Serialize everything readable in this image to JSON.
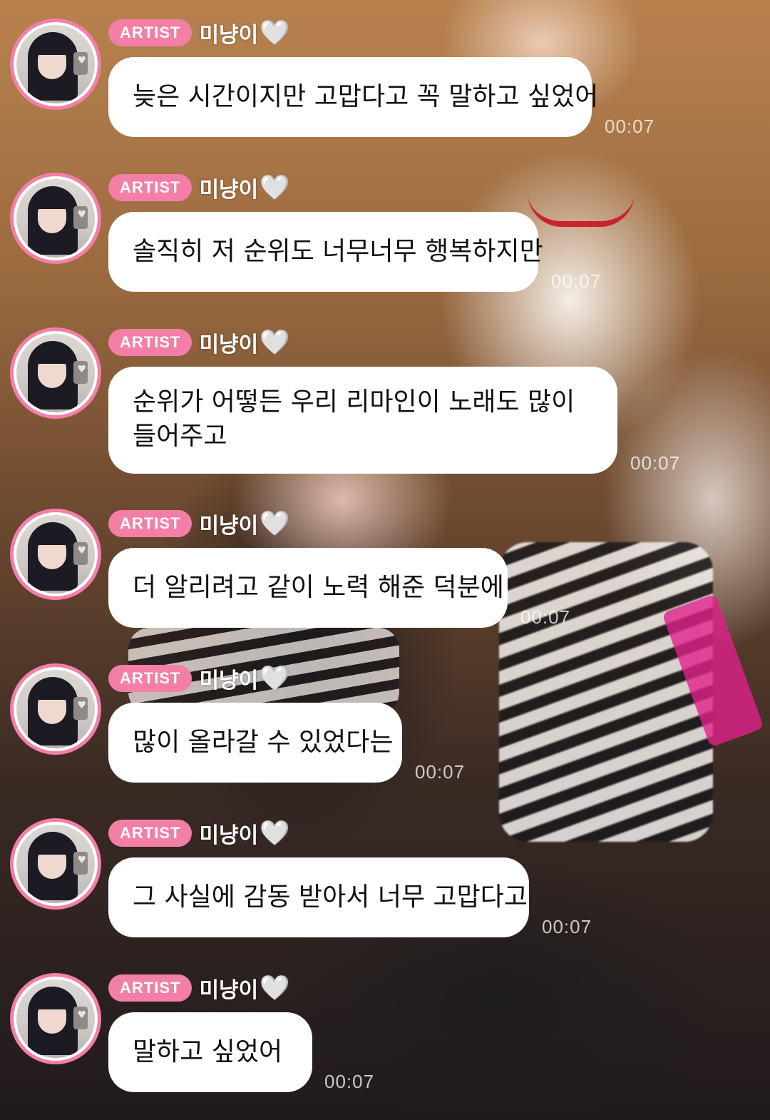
{
  "colors": {
    "badge": "#f37fa7",
    "avatar_ring": "#f47fa8",
    "bubble": "#ffffff",
    "text": "#111111"
  },
  "messages": [
    {
      "badge": "ARTIST",
      "username": "미냥이",
      "heart": "🤍",
      "text": "늦은 시간이지만 고맙다고 꼭 말하고 싶었어",
      "time": "00:07"
    },
    {
      "badge": "ARTIST",
      "username": "미냥이",
      "heart": "🤍",
      "text": "솔직히 저 순위도 너무너무 행복하지만",
      "time": "00:07"
    },
    {
      "badge": "ARTIST",
      "username": "미냥이",
      "heart": "🤍",
      "text": "순위가 어떻든 우리 리마인이 노래도 많이 들어주고",
      "time": "00:07"
    },
    {
      "badge": "ARTIST",
      "username": "미냥이",
      "heart": "🤍",
      "text": "더 알리려고 같이 노력 해준 덕분에",
      "time": "00:07"
    },
    {
      "badge": "ARTIST",
      "username": "미냥이",
      "heart": "🤍",
      "text": "많이 올라갈 수 있었다는",
      "time": "00:07"
    },
    {
      "badge": "ARTIST",
      "username": "미냥이",
      "heart": "🤍",
      "text": "그 사실에 감동 받아서 너무 고맙다고",
      "time": "00:07"
    },
    {
      "badge": "ARTIST",
      "username": "미냥이",
      "heart": "🤍",
      "text": "말하고 싶었어",
      "time": "00:07"
    }
  ]
}
